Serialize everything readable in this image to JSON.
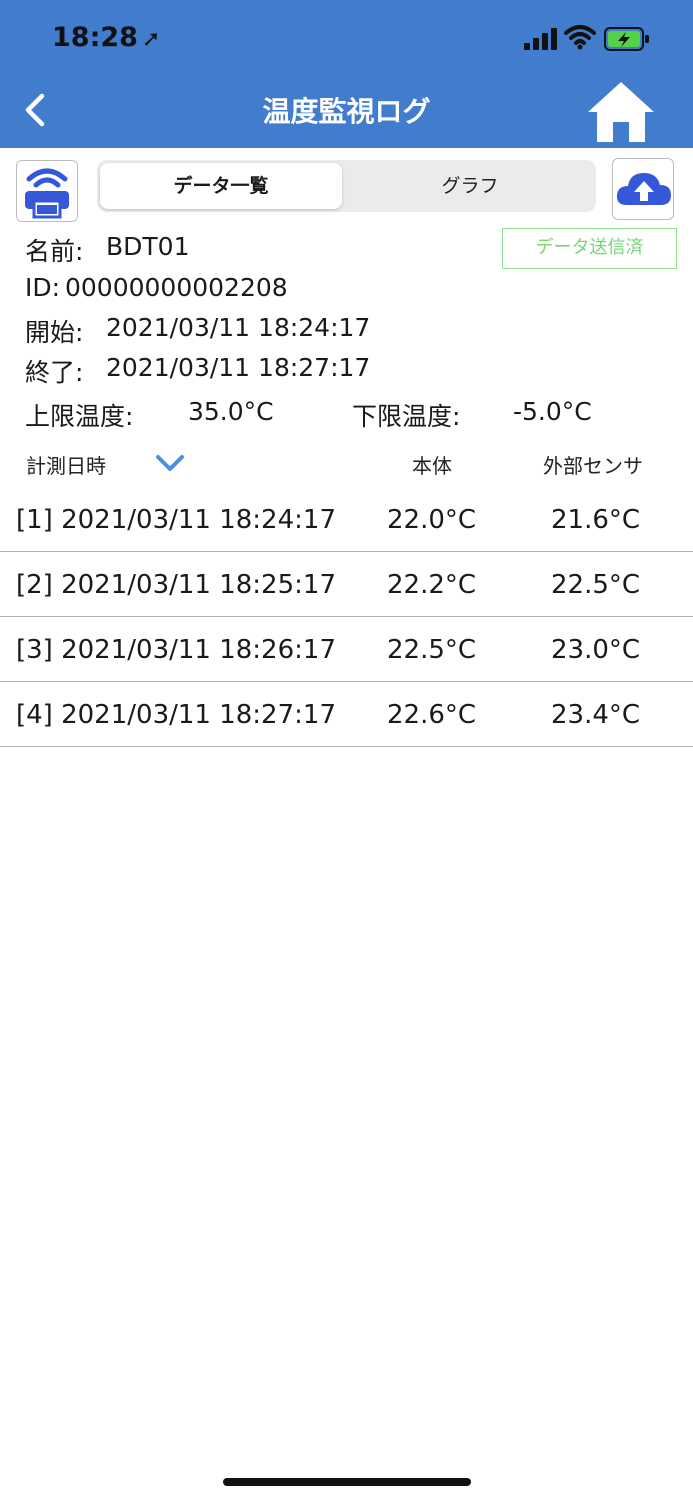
{
  "status_bar": {
    "time": "18:28"
  },
  "nav": {
    "title": "温度監視ログ"
  },
  "tabs": [
    {
      "label": "データ一覧",
      "active": true
    },
    {
      "label": "グラフ",
      "active": false
    }
  ],
  "sent_badge": "データ送信済",
  "info": {
    "name_label": "名前:",
    "name_value": "BDT01",
    "id_label": "ID:",
    "id_value": "00000000002208",
    "start_label": "開始:",
    "start_value": "2021/03/11 18:24:17",
    "end_label": "終了:",
    "end_value": "2021/03/11 18:27:17",
    "upper_label": "上限温度:",
    "upper_value": "35.0°C",
    "lower_label": "下限温度:",
    "lower_value": "-5.0°C"
  },
  "table": {
    "headers": [
      "計測日時",
      "本体",
      "外部センサ"
    ],
    "rows": [
      {
        "datetime": "[1] 2021/03/11 18:24:17",
        "body": "22.0°C",
        "external": "21.6°C"
      },
      {
        "datetime": "[2] 2021/03/11 18:25:17",
        "body": "22.2°C",
        "external": "22.5°C"
      },
      {
        "datetime": "[3] 2021/03/11 18:26:17",
        "body": "22.5°C",
        "external": "23.0°C"
      },
      {
        "datetime": "[4] 2021/03/11 18:27:17",
        "body": "22.6°C",
        "external": "23.4°C"
      }
    ]
  },
  "colors": {
    "header_bg": "#427ccd",
    "icon_blue": "#3558d8",
    "badge_green": "#74d674",
    "chevron_blue": "#4a90e2",
    "battery_green": "#52d34a"
  },
  "icons": {
    "location": "location-arrow-icon",
    "signal": "cellular-signal-icon",
    "wifi": "wifi-icon",
    "battery": "battery-charging-icon",
    "back": "chevron-left-icon",
    "home": "home-icon",
    "printer": "wireless-printer-icon",
    "upload": "cloud-upload-icon",
    "sort": "chevron-down-icon"
  }
}
